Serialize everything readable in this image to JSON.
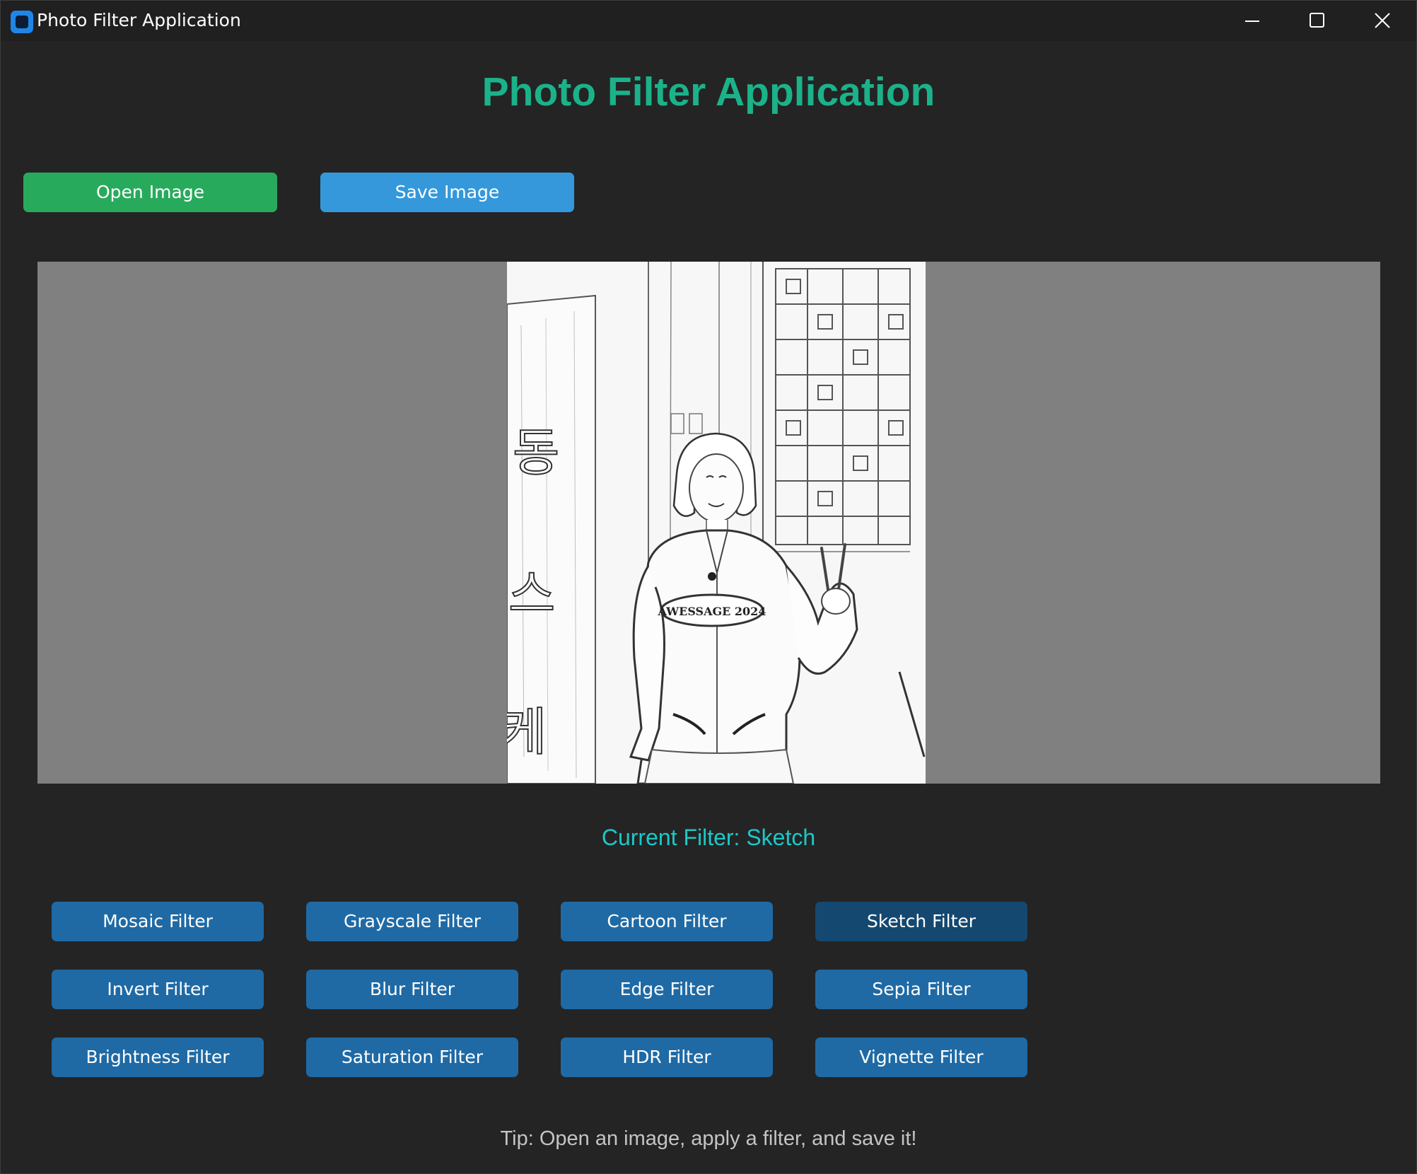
{
  "window": {
    "title": "Photo Filter Application",
    "controls": [
      "minimize",
      "maximize",
      "close"
    ]
  },
  "header": {
    "title": "Photo Filter Application"
  },
  "toolbar": {
    "open_label": "Open Image",
    "save_label": "Save Image"
  },
  "preview": {
    "photo_sign_text": "AWESSAGE 2024",
    "photo_hangul": [
      "동",
      "스",
      "케"
    ]
  },
  "status": {
    "current_filter": "Current Filter: Sketch"
  },
  "filters": [
    {
      "label": "Mosaic Filter",
      "active": false
    },
    {
      "label": "Grayscale Filter",
      "active": false
    },
    {
      "label": "Cartoon Filter",
      "active": false
    },
    {
      "label": "Sketch Filter",
      "active": true
    },
    {
      "label": "Invert Filter",
      "active": false
    },
    {
      "label": "Blur Filter",
      "active": false
    },
    {
      "label": "Edge Filter",
      "active": false
    },
    {
      "label": "Sepia Filter",
      "active": false
    },
    {
      "label": "Brightness Filter",
      "active": false
    },
    {
      "label": "Saturation Filter",
      "active": false
    },
    {
      "label": "HDR Filter",
      "active": false
    },
    {
      "label": "Vignette Filter",
      "active": false
    }
  ],
  "footer": {
    "tip": "Tip: Open an image, apply a filter, and save it!"
  },
  "colors": {
    "background": "#242424",
    "titlebar": "#202020",
    "title_accent": "#1bb28a",
    "open_button": "#28aa5c",
    "save_button": "#3498db",
    "filter_button": "#1f6aa5",
    "filter_button_active": "#144870",
    "status_text": "#1cc8c8",
    "canvas": "#808080"
  },
  "icons": {
    "app": "app-icon",
    "minimize": "minimize-icon",
    "maximize": "maximize-icon",
    "close": "close-icon"
  }
}
